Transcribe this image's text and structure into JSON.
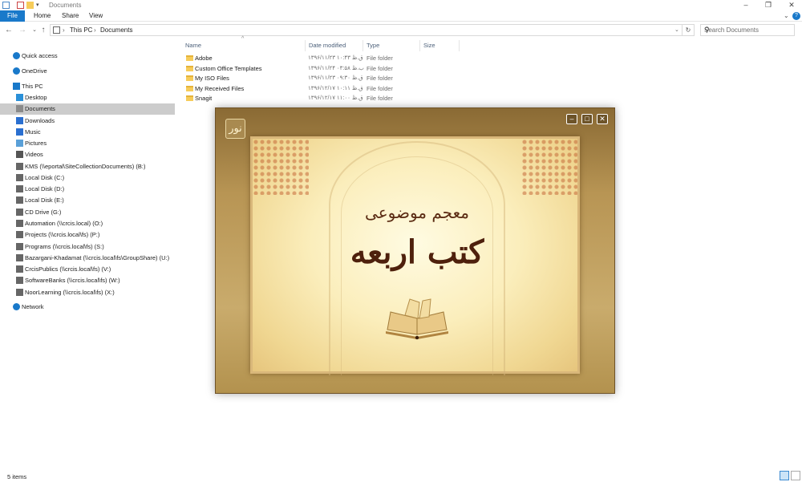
{
  "window": {
    "title": "Documents"
  },
  "ribbon": {
    "tabs": [
      "File",
      "Home",
      "Share",
      "View"
    ]
  },
  "address": {
    "segments": [
      "This PC",
      "Documents"
    ],
    "search_placeholder": "Search Documents"
  },
  "nav": {
    "items": [
      {
        "label": "Quick access",
        "icon": "star-icon",
        "color": "#1979ca"
      },
      {
        "label": "OneDrive",
        "icon": "cloud-icon",
        "color": "#1979ca"
      },
      {
        "label": "This PC",
        "icon": "computer-icon",
        "color": "#1979ca"
      },
      {
        "label": "Desktop",
        "icon": "desktop-icon",
        "color": "#2a90d8"
      },
      {
        "label": "Documents",
        "icon": "documents-icon",
        "color": "#8a8a8a"
      },
      {
        "label": "Downloads",
        "icon": "download-icon",
        "color": "#2a6fd0"
      },
      {
        "label": "Music",
        "icon": "music-icon",
        "color": "#2a6fd0"
      },
      {
        "label": "Pictures",
        "icon": "pictures-icon",
        "color": "#5aa0d8"
      },
      {
        "label": "Videos",
        "icon": "videos-icon",
        "color": "#555"
      },
      {
        "label": "KMS (\\\\eportal\\SiteCollectionDocuments) (B:)",
        "icon": "network-drive-icon",
        "color": "#666"
      },
      {
        "label": "Local Disk (C:)",
        "icon": "disk-icon",
        "color": "#666"
      },
      {
        "label": "Local Disk (D:)",
        "icon": "disk-icon",
        "color": "#666"
      },
      {
        "label": "Local Disk (E:)",
        "icon": "disk-icon",
        "color": "#666"
      },
      {
        "label": "CD Drive (G:)",
        "icon": "cd-icon",
        "color": "#666"
      },
      {
        "label": "Automation (\\\\crcis.local) (O:)",
        "icon": "network-drive-icon",
        "color": "#666"
      },
      {
        "label": "Projects (\\\\crcis.local\\fs) (P:)",
        "icon": "network-drive-icon",
        "color": "#666"
      },
      {
        "label": "Programs (\\\\crcis.local\\fs) (S:)",
        "icon": "network-drive-icon",
        "color": "#666"
      },
      {
        "label": "Bazargani-Khadamat (\\\\crcis.local\\fs\\GroupShare) (U:)",
        "icon": "network-drive-icon",
        "color": "#666"
      },
      {
        "label": "CrcisPublics (\\\\crcis.local\\fs) (V:)",
        "icon": "network-drive-icon",
        "color": "#666"
      },
      {
        "label": "SoftwareBanks (\\\\crcis.local\\fs) (W:)",
        "icon": "network-drive-icon",
        "color": "#666"
      },
      {
        "label": "NoorLearning (\\\\crcis.local\\fs) (X:)",
        "icon": "network-drive-icon",
        "color": "#666"
      },
      {
        "label": "Network",
        "icon": "network-icon",
        "color": "#1979ca"
      }
    ]
  },
  "files": {
    "columns": [
      "Name",
      "Date modified",
      "Type",
      "Size"
    ],
    "rows": [
      {
        "name": "Adobe",
        "date": "۱۳۹۶/۱۱/۲۳ ق.ظ ۱۰:۴۳",
        "type": "File folder"
      },
      {
        "name": "Custom Office Templates",
        "date": "۱۳۹۶/۱۱/۲۴ ب.ظ ۰۳:۵۸",
        "type": "File folder"
      },
      {
        "name": "My ISO Files",
        "date": "۱۳۹۶/۱۱/۲۳ ق.ظ ۰۹:۳۰",
        "type": "File folder"
      },
      {
        "name": "My Received Files",
        "date": "۱۳۹۶/۱۲/۱۷ ق.ظ ۱۰:۱۱",
        "type": "File folder"
      },
      {
        "name": "Snagit",
        "date": "۱۳۹۶/۱۲/۱۷ ق.ظ ۱۱:۰۰",
        "type": "File folder"
      }
    ]
  },
  "status": {
    "items_count": "5 items"
  },
  "splash": {
    "title_small": "معجم موضوعی",
    "title_large": "کتب اربعه",
    "logo_glyph": "نور"
  }
}
